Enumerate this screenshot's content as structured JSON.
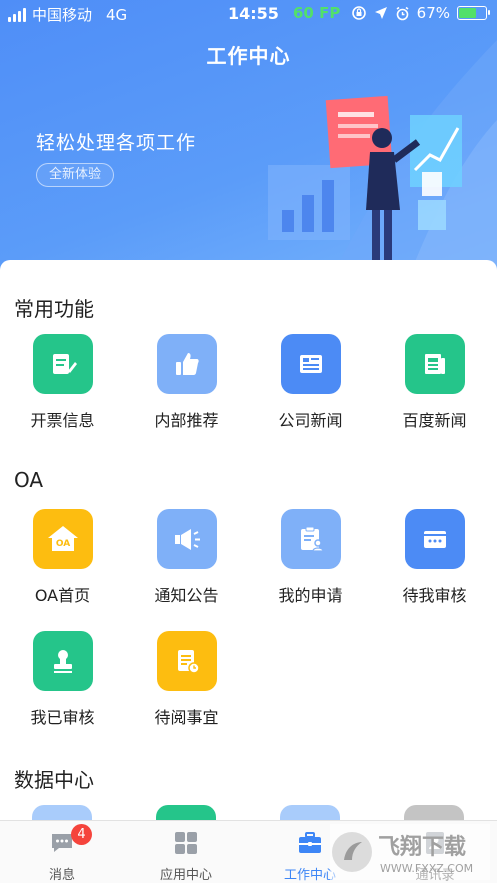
{
  "status_bar": {
    "carrier": "中国移动",
    "network": "4G",
    "time": "14:55",
    "fps": "60 FP",
    "battery": "67%",
    "battery_level": 0.67
  },
  "header": {
    "title": "工作中心"
  },
  "banner": {
    "slogan": "轻松处理各项工作",
    "tag": "全新体验"
  },
  "sections": {
    "common": {
      "title": "常用功能",
      "items": [
        {
          "label": "开票信息",
          "icon": "invoice-pen-icon",
          "color": "#25c58a"
        },
        {
          "label": "内部推荐",
          "icon": "thumbs-up-icon",
          "color": "#7fb0f8"
        },
        {
          "label": "公司新闻",
          "icon": "news-icon",
          "color": "#4c8bf5"
        },
        {
          "label": "百度新闻",
          "icon": "newspaper-icon",
          "color": "#25c58a"
        }
      ]
    },
    "oa": {
      "title": "OA",
      "items": [
        {
          "label": "OA首页",
          "icon": "oa-home-icon",
          "color": "#fdbd10",
          "glyph": "OA"
        },
        {
          "label": "通知公告",
          "icon": "megaphone-icon",
          "color": "#7fb0f8"
        },
        {
          "label": "我的申请",
          "icon": "clipboard-user-icon",
          "color": "#7fb0f8"
        },
        {
          "label": "待我审核",
          "icon": "card-icon",
          "color": "#4c8bf5"
        },
        {
          "label": "我已审核",
          "icon": "stamp-icon",
          "color": "#25c58a"
        },
        {
          "label": "待阅事宜",
          "icon": "document-clock-icon",
          "color": "#fdbd10"
        }
      ]
    },
    "data_center": {
      "title": "数据中心"
    }
  },
  "tabbar": {
    "items": [
      {
        "label": "消息",
        "icon": "message-icon",
        "badge": "4"
      },
      {
        "label": "应用中心",
        "icon": "grid-icon"
      },
      {
        "label": "工作中心",
        "icon": "briefcase-icon",
        "active": true
      },
      {
        "label": "通讯录",
        "icon": "contacts-icon"
      }
    ]
  },
  "watermark": {
    "text": "飞翔下载",
    "url": "WWW.FXXZ.COM"
  },
  "colors": {
    "primary": "#3d86f6",
    "green": "#25c58a",
    "yellow": "#fdbd10",
    "light_blue": "#7fb0f8",
    "badge": "#f5443c"
  }
}
